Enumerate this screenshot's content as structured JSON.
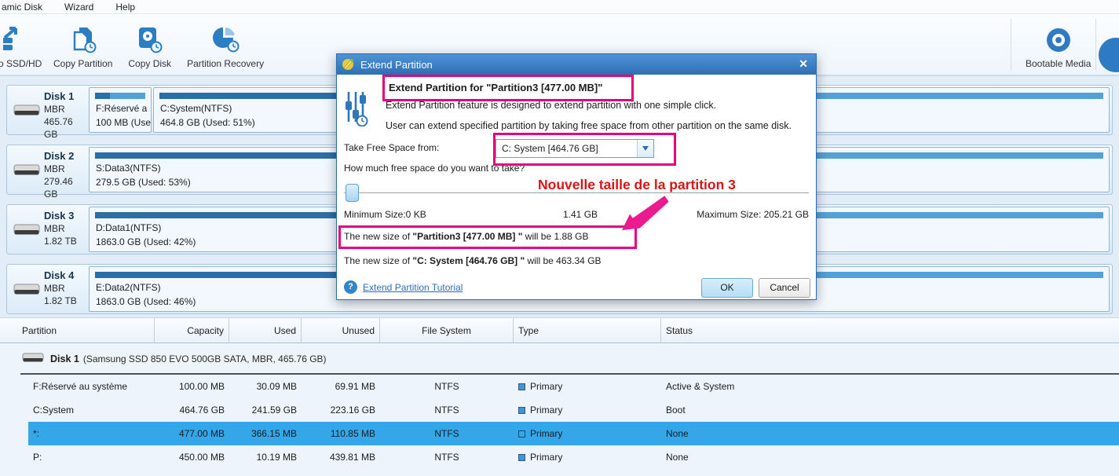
{
  "menu": {
    "items": [
      "amic Disk",
      "Wizard",
      "Help"
    ]
  },
  "toolbar": {
    "buttons": [
      {
        "label": "to SSD/HD",
        "icon": "migrate-to-ssd-icon",
        "cutoff": true
      },
      {
        "label": "Copy Partition",
        "icon": "copy-partition-icon",
        "cutoff": false
      },
      {
        "label": "Copy Disk",
        "icon": "copy-disk-icon",
        "cutoff": false
      },
      {
        "label": "Partition Recovery",
        "icon": "partition-recovery-icon",
        "cutoff": false
      }
    ],
    "right_button": {
      "label": "Bootable Media",
      "icon": "bootable-media-icon"
    }
  },
  "disks": [
    {
      "name": "Disk 1",
      "style": "MBR",
      "size": "465.76 GB",
      "partitions": [
        {
          "label": "F:Réservé a",
          "detail": "100 MB (Use",
          "used_pct": 30
        },
        {
          "label": "C:System(NTFS)",
          "detail": "464.8 GB (Used: 51%)",
          "used_pct": 51
        }
      ]
    },
    {
      "name": "Disk 2",
      "style": "MBR",
      "size": "279.46 GB",
      "partitions": [
        {
          "label": "S:Data3(NTFS)",
          "detail": "279.5 GB (Used: 53%)",
          "used_pct": 53
        }
      ]
    },
    {
      "name": "Disk 3",
      "style": "MBR",
      "size": "1.82 TB",
      "partitions": [
        {
          "label": "D:Data1(NTFS)",
          "detail": "1863.0 GB (Used: 42%)",
          "used_pct": 42
        }
      ]
    },
    {
      "name": "Disk 4",
      "style": "MBR",
      "size": "1.82 TB",
      "partitions": [
        {
          "label": "E:Data2(NTFS)",
          "detail": "1863.0 GB (Used: 46%)",
          "used_pct": 46
        }
      ]
    }
  ],
  "dialog": {
    "title": "Extend Partition",
    "close_glyph": "✕",
    "heading": "Extend Partition for \"Partition3 [477.00 MB]\"",
    "desc1": "Extend Partition feature is designed to extend partition with one simple click.",
    "desc2": "User can extend specified partition by taking free space from other partition on the same disk.",
    "take_label": "Take Free Space from:",
    "dropdown_value": "C: System [464.76 GB]",
    "question": "How much free space do you want to take?",
    "min_label": "Minimum Size:0 KB",
    "current_value": "1.41 GB",
    "max_label": "Maximum Size: 205.21 GB",
    "newsize1_prefix": "The new size of ",
    "newsize1_bold": "\"Partition3 [477.00 MB] \"",
    "newsize1_suffix": " will be 1.88 GB",
    "newsize2_prefix": "The new size of ",
    "newsize2_bold": "\"C: System [464.76 GB] \"",
    "newsize2_suffix": " will be 463.34 GB",
    "help_glyph": "?",
    "tutorial_link": "Extend Partition Tutorial",
    "ok_label": "OK",
    "cancel_label": "Cancel"
  },
  "annotation": {
    "text": "Nouvelle taille de la partition 3",
    "text_color": "#dc1414",
    "highlight_color": "#e5017e"
  },
  "table": {
    "headers": [
      "Partition",
      "Capacity",
      "Used",
      "Unused",
      "File System",
      "Type",
      "Status"
    ],
    "group": {
      "name": "Disk 1",
      "detail": "(Samsung SSD 850 EVO 500GB SATA, MBR, 465.76 GB)"
    },
    "rows": [
      {
        "partition": "F:Réservé au système",
        "capacity": "100.00 MB",
        "used": "30.09 MB",
        "unused": "69.91 MB",
        "fs": "NTFS",
        "type": "Primary",
        "status": "Active & System",
        "selected": false
      },
      {
        "partition": "C:System",
        "capacity": "464.76 GB",
        "used": "241.59 GB",
        "unused": "223.16 GB",
        "fs": "NTFS",
        "type": "Primary",
        "status": "Boot",
        "selected": false
      },
      {
        "partition": "*:",
        "capacity": "477.00 MB",
        "used": "366.15 MB",
        "unused": "110.85 MB",
        "fs": "NTFS",
        "type": "Primary",
        "status": "None",
        "selected": true
      },
      {
        "partition": "P:",
        "capacity": "450.00 MB",
        "used": "10.19 MB",
        "unused": "439.81 MB",
        "fs": "NTFS",
        "type": "Primary",
        "status": "None",
        "selected": false
      }
    ]
  },
  "colors": {
    "bar_used": "#2d6da6",
    "bar_free": "#52a1d8",
    "selected_row": "#35a7e9",
    "accent_blue": "#2f7bc3"
  }
}
